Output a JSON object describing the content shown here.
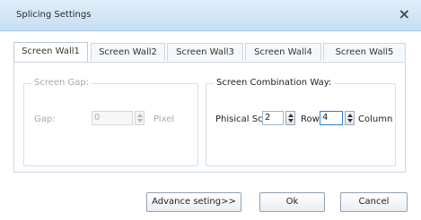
{
  "window": {
    "title": "Splicing Settings",
    "close_label": "×"
  },
  "tabs": [
    {
      "label": "Screen Wall1",
      "active": true
    },
    {
      "label": "Screen Wall2",
      "active": false
    },
    {
      "label": "Screen Wall3",
      "active": false
    },
    {
      "label": "Screen Wall4",
      "active": false
    },
    {
      "label": "Screen Wall5",
      "active": false
    }
  ],
  "screen_gap": {
    "title": "Screen Gap:",
    "gap_label": "Gap:",
    "gap_value": "0",
    "unit": "Pixel",
    "enabled": false
  },
  "combination": {
    "title": "Screen Combination Way:",
    "physical_label": "Phisical Sc",
    "row_value": "2",
    "row_label": "Row",
    "column_value": "4",
    "column_label": "Column"
  },
  "buttons": {
    "advance": "Advance seting>>",
    "ok": "Ok",
    "cancel": "Cancel"
  },
  "colors": {
    "titlebar": "#c7def3",
    "border": "#c9d6e3",
    "disabled_text": "#a8a8a8"
  }
}
